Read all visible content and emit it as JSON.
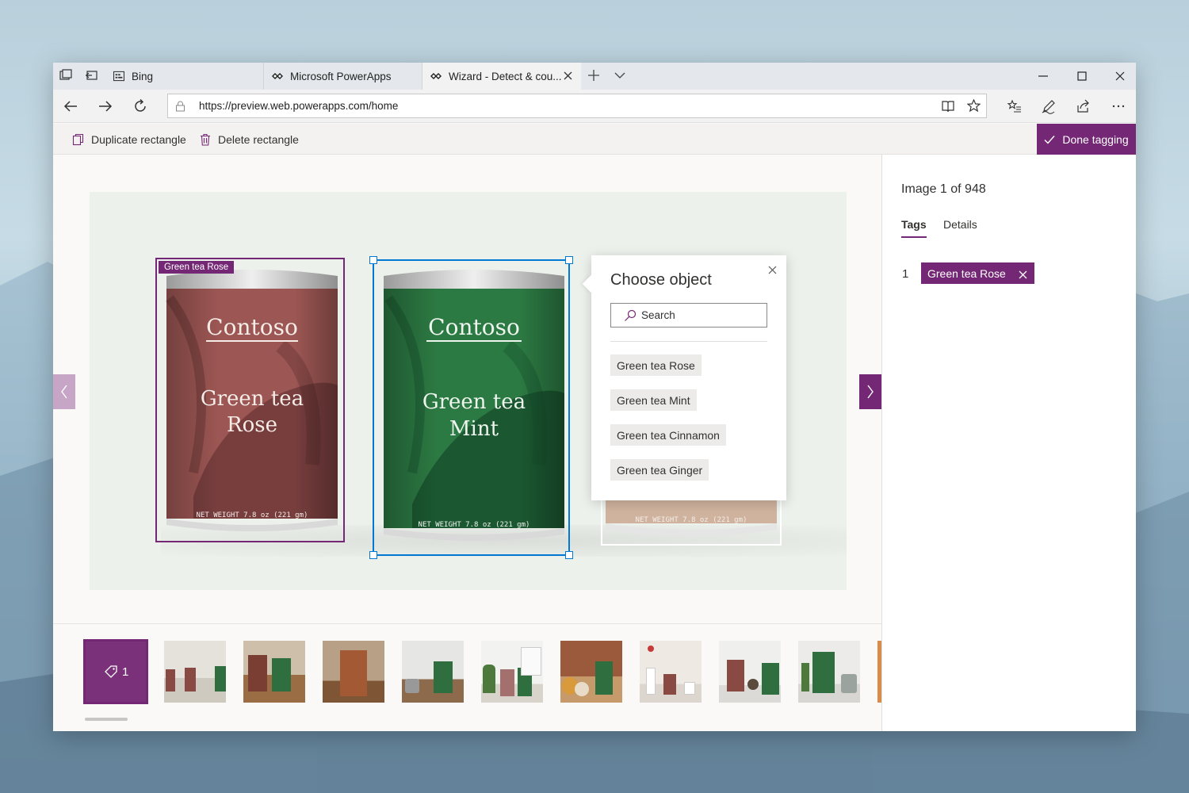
{
  "browser": {
    "tabs": [
      {
        "label": "Bing",
        "active": false
      },
      {
        "label": "Microsoft PowerApps",
        "active": false
      },
      {
        "label": "Wizard - Detect & cou...",
        "active": true
      }
    ],
    "url": "https://preview.web.powerapps.com/home"
  },
  "toolbar": {
    "duplicate_label": "Duplicate rectangle",
    "delete_label": "Delete rectangle",
    "done_label": "Done tagging"
  },
  "cans": [
    {
      "brand": "Contoso",
      "name_line1": "Green tea",
      "name_line2": "Rose",
      "weight": "NET WEIGHT 7.8 oz (221 gm)",
      "color": "#9c5653"
    },
    {
      "brand": "Contoso",
      "name_line1": "Green tea",
      "name_line2": "Mint",
      "weight": "NET WEIGHT 7.8 oz (221 gm)",
      "color": "#2c7a43"
    },
    {
      "weight": "NET WEIGHT 7.8 oz (221 gm)",
      "color": "#b7805e"
    }
  ],
  "bbox_label": "Green tea Rose",
  "popup": {
    "title": "Choose object",
    "search_placeholder": "Search",
    "options": [
      "Green tea Rose",
      "Green tea Mint",
      "Green tea Cinnamon",
      "Green tea Ginger"
    ]
  },
  "panel": {
    "counter": "Image 1 of 948",
    "tabs": [
      "Tags",
      "Details"
    ],
    "tag_index": "1",
    "tag_label": "Green tea Rose"
  },
  "filmstrip": {
    "selected_count": "1",
    "thumb_count": 10
  },
  "colors": {
    "accent": "#742774",
    "selection": "#0078d4"
  }
}
